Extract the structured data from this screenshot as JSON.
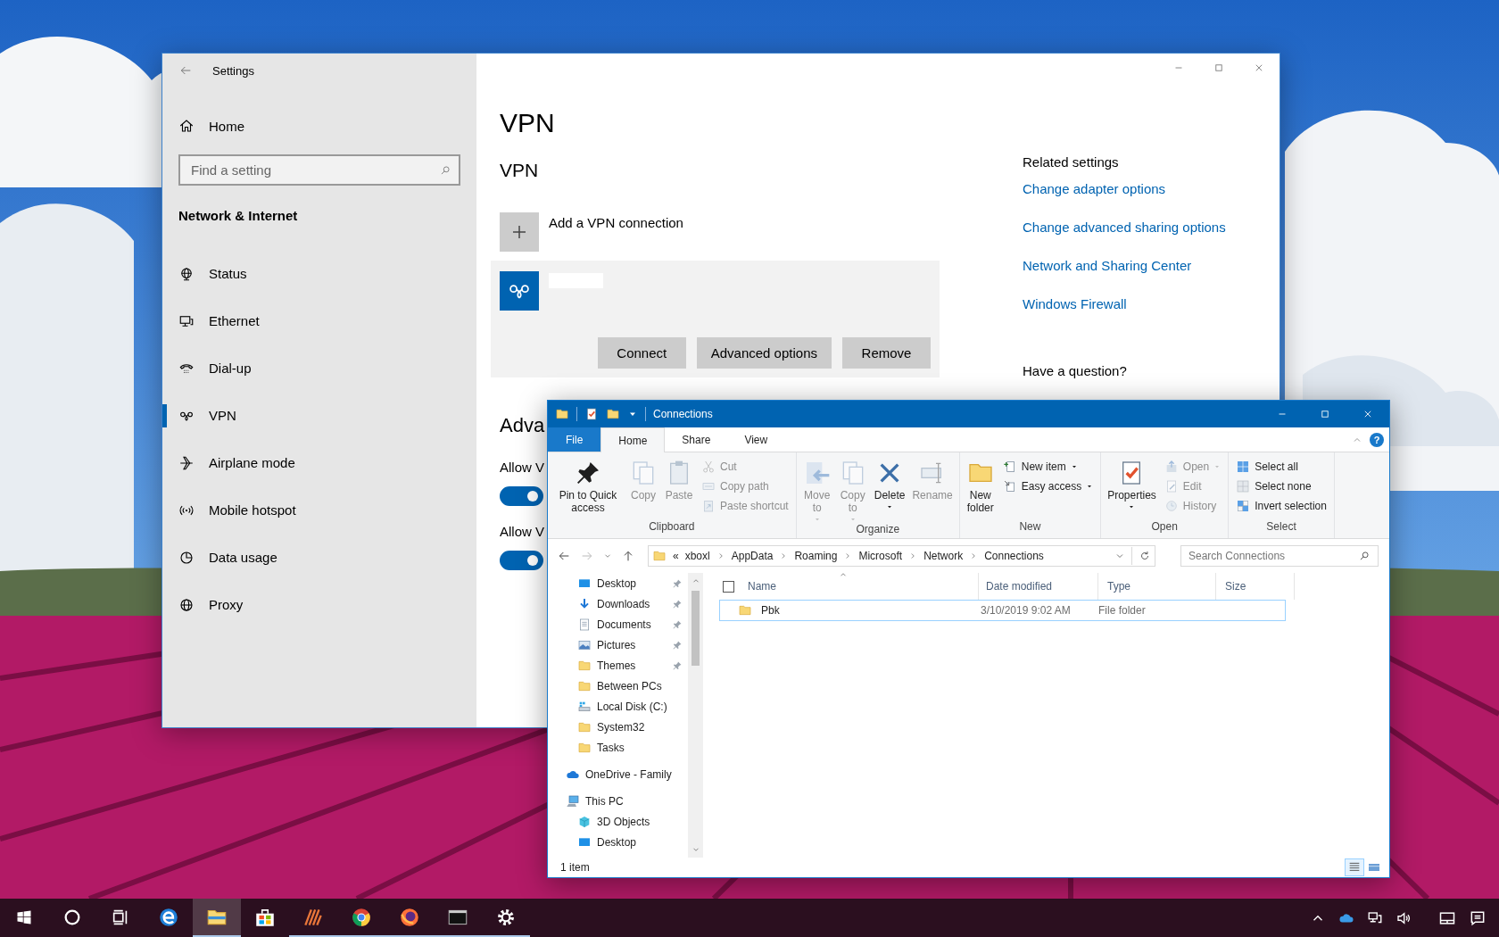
{
  "settings": {
    "title": "Settings",
    "home": "Home",
    "search": {
      "placeholder": "Find a setting"
    },
    "section": "Network & Internet",
    "nav": [
      {
        "label": "Status",
        "kind": "status",
        "selected": false
      },
      {
        "label": "Ethernet",
        "kind": "ethernet",
        "selected": false
      },
      {
        "label": "Dial-up",
        "kind": "dialup",
        "selected": false
      },
      {
        "label": "VPN",
        "kind": "vpn",
        "selected": true
      },
      {
        "label": "Airplane mode",
        "kind": "airplane",
        "selected": false
      },
      {
        "label": "Mobile hotspot",
        "kind": "hotspot",
        "selected": false
      },
      {
        "label": "Data usage",
        "kind": "data",
        "selected": false
      },
      {
        "label": "Proxy",
        "kind": "proxy",
        "selected": false
      }
    ],
    "page_title": "VPN",
    "heading": "VPN",
    "add_connection": "Add a VPN connection",
    "connection": {
      "buttons": [
        "Connect",
        "Advanced options",
        "Remove"
      ]
    },
    "advanced_heading": "Adva",
    "toggles": [
      {
        "label": "Allow V",
        "on": true
      },
      {
        "label": "Allow V",
        "on": true
      }
    ],
    "related": {
      "title": "Related settings",
      "links": [
        "Change adapter options",
        "Change advanced sharing options",
        "Network and Sharing Center",
        "Windows Firewall"
      ]
    },
    "question": "Have a question?"
  },
  "explorer": {
    "title": "Connections",
    "tabs": [
      {
        "label": "File",
        "kind": "file",
        "selected": false
      },
      {
        "label": "Home",
        "kind": "tab",
        "selected": true
      },
      {
        "label": "Share",
        "kind": "tab",
        "selected": false
      },
      {
        "label": "View",
        "kind": "tab",
        "selected": false
      }
    ],
    "help": "?",
    "ribbon": [
      {
        "label": "Clipboard",
        "items": [
          {
            "label": "Pin to Quick access",
            "kind": "large",
            "disabled": false,
            "dropdown": false
          },
          {
            "label": "Copy",
            "kind": "large",
            "disabled": true,
            "dropdown": false
          },
          {
            "label": "Paste",
            "kind": "large",
            "disabled": true,
            "dropdown": false
          },
          {
            "label": "Cut",
            "kind": "small",
            "disabled": true,
            "dropdown": false
          },
          {
            "label": "Copy path",
            "kind": "small",
            "disabled": true,
            "dropdown": false
          },
          {
            "label": "Paste shortcut",
            "kind": "small",
            "disabled": true,
            "dropdown": false
          }
        ]
      },
      {
        "label": "Organize",
        "items": [
          {
            "label": "Move to",
            "kind": "large",
            "disabled": true,
            "dropdown": true
          },
          {
            "label": "Copy to",
            "kind": "large",
            "disabled": true,
            "dropdown": true
          },
          {
            "label": "Delete",
            "kind": "large",
            "disabled": false,
            "dropdown": true
          },
          {
            "label": "Rename",
            "kind": "large",
            "disabled": true,
            "dropdown": false
          }
        ]
      },
      {
        "label": "New",
        "items": [
          {
            "label": "New folder",
            "kind": "large",
            "disabled": false,
            "dropdown": false
          },
          {
            "label": "New item",
            "kind": "small",
            "disabled": false,
            "dropdown": true
          },
          {
            "label": "Easy access",
            "kind": "small",
            "disabled": false,
            "dropdown": true
          }
        ]
      },
      {
        "label": "Open",
        "items": [
          {
            "label": "Properties",
            "kind": "large",
            "disabled": false,
            "dropdown": true
          },
          {
            "label": "Open",
            "kind": "small",
            "disabled": true,
            "dropdown": true
          },
          {
            "label": "Edit",
            "kind": "small",
            "disabled": true,
            "dropdown": false
          },
          {
            "label": "History",
            "kind": "small",
            "disabled": true,
            "dropdown": false
          }
        ]
      },
      {
        "label": "Select",
        "items": [
          {
            "label": "Select all",
            "kind": "small",
            "disabled": false,
            "dropdown": false
          },
          {
            "label": "Select none",
            "kind": "small",
            "disabled": false,
            "dropdown": false
          },
          {
            "label": "Invert selection",
            "kind": "small",
            "disabled": false,
            "dropdown": false
          }
        ]
      }
    ],
    "address": {
      "overflow": "«",
      "crumbs": [
        "xboxl",
        "AppData",
        "Roaming",
        "Microsoft",
        "Network",
        "Connections"
      ]
    },
    "search": {
      "placeholder": "Search Connections"
    },
    "quick_access": [
      {
        "label": "Desktop",
        "kind": "desktop",
        "pinned": true
      },
      {
        "label": "Downloads",
        "kind": "download",
        "pinned": true
      },
      {
        "label": "Documents",
        "kind": "document",
        "pinned": true
      },
      {
        "label": "Pictures",
        "kind": "pictures",
        "pinned": true
      },
      {
        "label": "Themes",
        "kind": "folder",
        "pinned": true
      },
      {
        "label": "Between PCs",
        "kind": "folder",
        "pinned": false
      },
      {
        "label": "Local Disk (C:)",
        "kind": "drive",
        "pinned": false
      },
      {
        "label": "System32",
        "kind": "folder",
        "pinned": false
      },
      {
        "label": "Tasks",
        "kind": "folder",
        "pinned": false
      }
    ],
    "tree": [
      {
        "label": "OneDrive - Family",
        "kind": "cloud"
      },
      {
        "label": "This PC",
        "kind": "pc",
        "children": [
          {
            "label": "3D Objects",
            "kind": "cube"
          },
          {
            "label": "Desktop",
            "kind": "desktop"
          }
        ]
      }
    ],
    "header_checkbox": {
      "checked": false
    },
    "columns": [
      "Name",
      "Date modified",
      "Type",
      "Size"
    ],
    "files": [
      {
        "name": "Pbk",
        "date": "3/10/2019 9:02 AM",
        "type": "File folder",
        "focused": true
      }
    ],
    "status": "1 item",
    "views": [
      {
        "kind": "details",
        "selected": true
      },
      {
        "kind": "tiles",
        "selected": false
      }
    ]
  },
  "taskbar": {
    "apps": [
      {
        "kind": "edge",
        "running": false,
        "active": false
      },
      {
        "kind": "explorer",
        "running": true,
        "active": true
      },
      {
        "kind": "store",
        "running": false,
        "active": false
      },
      {
        "kind": "stripes",
        "running": true,
        "active": false
      },
      {
        "kind": "chrome",
        "running": true,
        "active": false
      },
      {
        "kind": "firefox",
        "running": true,
        "active": false
      },
      {
        "kind": "terminal",
        "running": true,
        "active": false
      },
      {
        "kind": "gear",
        "running": true,
        "active": false
      }
    ]
  }
}
